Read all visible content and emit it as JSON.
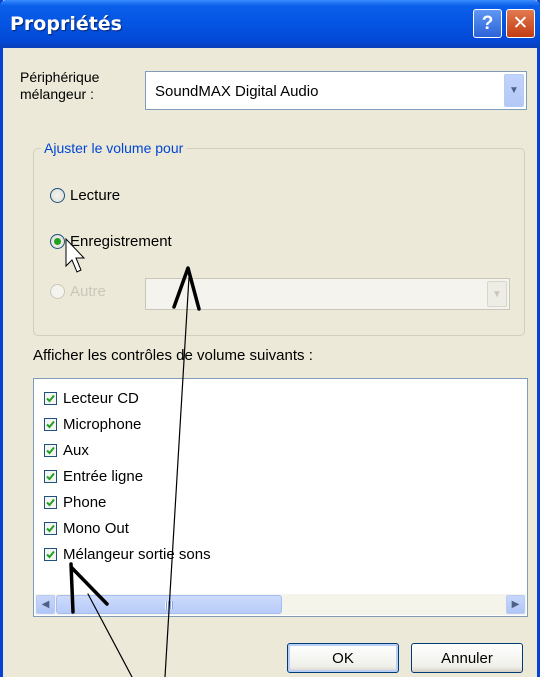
{
  "window": {
    "title": "Propriétés",
    "help_label": "?",
    "close_label": "✕"
  },
  "mixer": {
    "label": "Périphérique mélangeur :",
    "device": "SoundMAX Digital Audio"
  },
  "volume_group": {
    "legend": "Ajuster le volume pour",
    "options": [
      {
        "label": "Lecture",
        "checked": false,
        "enabled": true
      },
      {
        "label": "Enregistrement",
        "checked": true,
        "enabled": true
      },
      {
        "label": "Autre",
        "checked": false,
        "enabled": false
      }
    ],
    "other_value": ""
  },
  "controls": {
    "label": "Afficher les contrôles de volume suivants :",
    "items": [
      {
        "label": "Lecteur CD",
        "checked": true
      },
      {
        "label": "Microphone",
        "checked": true
      },
      {
        "label": "Aux",
        "checked": true
      },
      {
        "label": "Entrée ligne",
        "checked": true
      },
      {
        "label": "Phone",
        "checked": true
      },
      {
        "label": "Mono Out",
        "checked": true
      },
      {
        "label": "Mélangeur sortie sons",
        "checked": true
      }
    ]
  },
  "buttons": {
    "ok": "OK",
    "cancel": "Annuler"
  },
  "colors": {
    "titlebar": "#0454e3",
    "dialog_bg": "#ece9d8",
    "check_green": "#21a121",
    "group_legend": "#0046d5"
  }
}
